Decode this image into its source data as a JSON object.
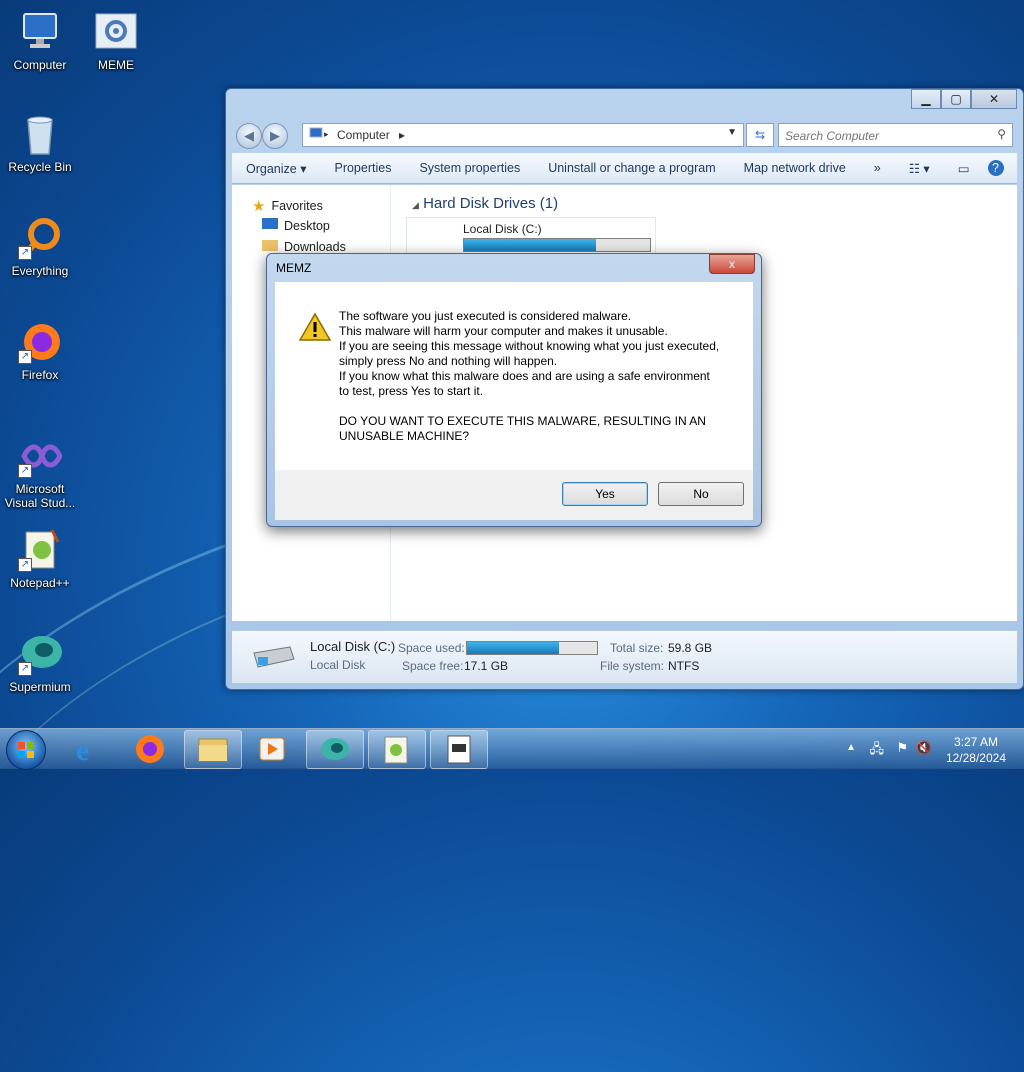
{
  "desktop": {
    "icons": [
      {
        "label": "Computer"
      },
      {
        "label": "MEME"
      },
      {
        "label": "Recycle Bin"
      },
      {
        "label": "Everything"
      },
      {
        "label": "Firefox"
      },
      {
        "label": "Microsoft Visual Stud..."
      },
      {
        "label": "Notepad++"
      },
      {
        "label": "Supermium"
      }
    ]
  },
  "explorer": {
    "address": "Computer",
    "search_placeholder": "Search Computer",
    "toolbar": [
      "Organize",
      "Properties",
      "System properties",
      "Uninstall or change a program",
      "Map network drive",
      "»"
    ],
    "nav": {
      "favorites": "Favorites",
      "desktop": "Desktop",
      "downloads": "Downloads"
    },
    "section_title": "Hard Disk Drives (1)",
    "drive": {
      "name": "Local Disk (C:)",
      "used_fraction": 0.71
    },
    "details": {
      "name": "Local Disk (C:)",
      "type": "Local Disk",
      "space_used_label": "Space used:",
      "space_free_label": "Space free:",
      "space_free": "17.1 GB",
      "total_size_label": "Total size:",
      "total_size": "59.8 GB",
      "file_system_label": "File system:",
      "file_system": "NTFS",
      "used_fraction": 0.71
    }
  },
  "dialog": {
    "title": "MEMZ",
    "close": "x",
    "message": "The software you just executed is considered malware.\nThis malware will harm your computer and makes it unusable.\nIf you are seeing this message without knowing what you just executed,\nsimply press No and nothing will happen.\nIf you know what this malware does and are using a safe environment\nto test, press Yes to start it.\n\nDO YOU WANT TO EXECUTE THIS MALWARE, RESULTING IN AN\nUNUSABLE MACHINE?",
    "yes": "Yes",
    "no": "No"
  },
  "taskbar": {
    "time": "3:27 AM",
    "date": "12/28/2024"
  },
  "colors": {
    "accent": "#1565b8",
    "dialog_frame": "#a9c4e3",
    "bar_fill": "#1a78b8"
  }
}
